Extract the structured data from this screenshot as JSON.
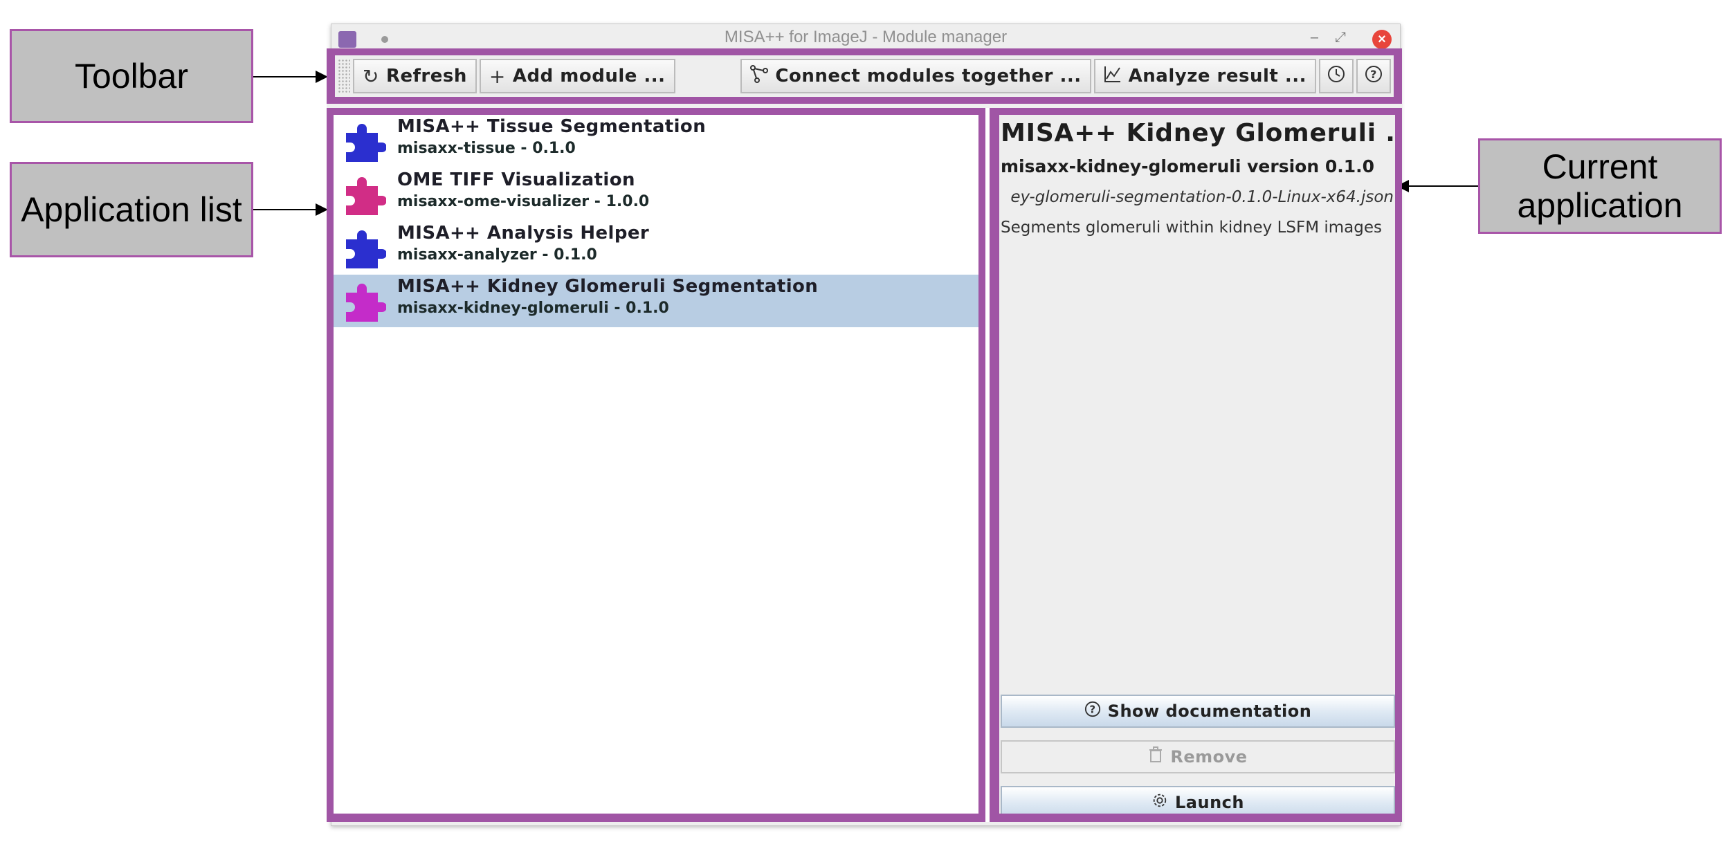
{
  "annotations": {
    "toolbar": "Toolbar",
    "application_list": "Application list",
    "current_application_line1": "Current",
    "current_application_line2": "application"
  },
  "window": {
    "title": "MISA++ for ImageJ - Module manager"
  },
  "toolbar": {
    "refresh_label": "Refresh",
    "add_module_label": "Add module ...",
    "connect_label": "Connect modules together ...",
    "analyze_label": "Analyze result ..."
  },
  "modules": [
    {
      "title": "MISA++ Tissue Segmentation",
      "subtitle": "misaxx-tissue - 0.1.0",
      "icon_color": "#2b2fcf"
    },
    {
      "title": "OME TIFF Visualization",
      "subtitle": "misaxx-ome-visualizer - 1.0.0",
      "icon_color": "#d12d86"
    },
    {
      "title": "MISA++ Analysis Helper",
      "subtitle": "misaxx-analyzer - 0.1.0",
      "icon_color": "#2b2fcf"
    },
    {
      "title": "MISA++ Kidney Glomeruli Segmentation",
      "subtitle": "misaxx-kidney-glomeruli - 0.1.0",
      "icon_color": "#c42cc9",
      "selected": true
    }
  ],
  "current": {
    "title": "MISA++ Kidney Glomeruli ...",
    "version": "misaxx-kidney-glomeruli version 0.1.0",
    "file": "ey-glomeruli-segmentation-0.1.0-Linux-x64.json",
    "description": "Segments glomeruli within kidney LSFM images",
    "show_doc_label": "Show documentation",
    "remove_label": "Remove",
    "launch_label": "Launch"
  },
  "colors": {
    "highlight_border": "#a055a5",
    "selection": "#b8cde3"
  }
}
